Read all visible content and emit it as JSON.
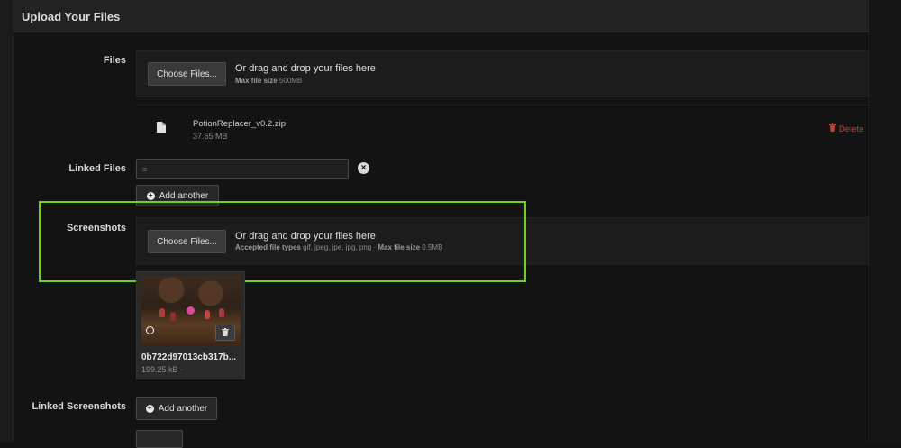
{
  "header": {
    "title": "Upload Your Files"
  },
  "files_section": {
    "label": "Files",
    "choose_button": "Choose Files...",
    "drag_text": "Or drag and drop your files here",
    "max_size_label": "Max file size",
    "max_size_value": "500MB"
  },
  "uploaded_file": {
    "name": "PotionReplacer_v0.2.zip",
    "size": "37.65 MB",
    "delete_label": "Delete",
    "icon": "file-icon"
  },
  "linked_files": {
    "label": "Linked Files",
    "input_value": "",
    "add_another": "Add another"
  },
  "screenshots": {
    "label": "Screenshots",
    "choose_button": "Choose Files...",
    "drag_text": "Or drag and drop your files here",
    "accepted_label": "Accepted file types",
    "accepted_value": "gif, jpeg, jpe, jpg, png",
    "separator": "·",
    "max_size_label": "Max file size",
    "max_size_value": "0.5MB"
  },
  "screenshot_item": {
    "name": "0b722d97013cb317b...",
    "size": "199.25 kB",
    "size_suffix": "·"
  },
  "linked_screenshots": {
    "label": "Linked Screenshots",
    "add_another": "Add another"
  },
  "colors": {
    "highlight": "#6fd11f",
    "delete": "#c0463c",
    "background": "#131313"
  }
}
